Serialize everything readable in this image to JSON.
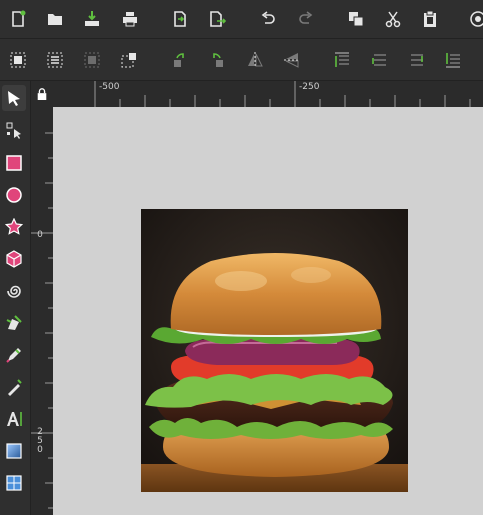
{
  "commands": [
    "new-document",
    "open-document",
    "save-document",
    "print-document",
    "import",
    "export",
    "undo",
    "redo",
    "duplicate",
    "cut",
    "paste",
    "zoom"
  ],
  "controls": [
    "select-all",
    "select-all-layers",
    "deselect",
    "select-same",
    "rotate-ccw",
    "rotate-cw",
    "flip-horizontal",
    "flip-vertical",
    "raise-to-top",
    "raise",
    "lower",
    "lower-to-bottom"
  ],
  "tools": [
    "selector",
    "node",
    "rectangle",
    "circle",
    "star",
    "3d-box",
    "spiral",
    "pen",
    "pencil",
    "calligraphy",
    "text",
    "gradient",
    "mesh"
  ],
  "ruler": {
    "h_labels": [
      "-500",
      "-250"
    ],
    "v_labels": [
      "0",
      "250"
    ]
  },
  "canvas": {
    "background": "#d1d1d1",
    "image_subject": "burger"
  },
  "colors": {
    "accent_green": "#5fbf3f",
    "accent_pink": "#e0457b",
    "ui_dark": "#2f2f2f"
  }
}
